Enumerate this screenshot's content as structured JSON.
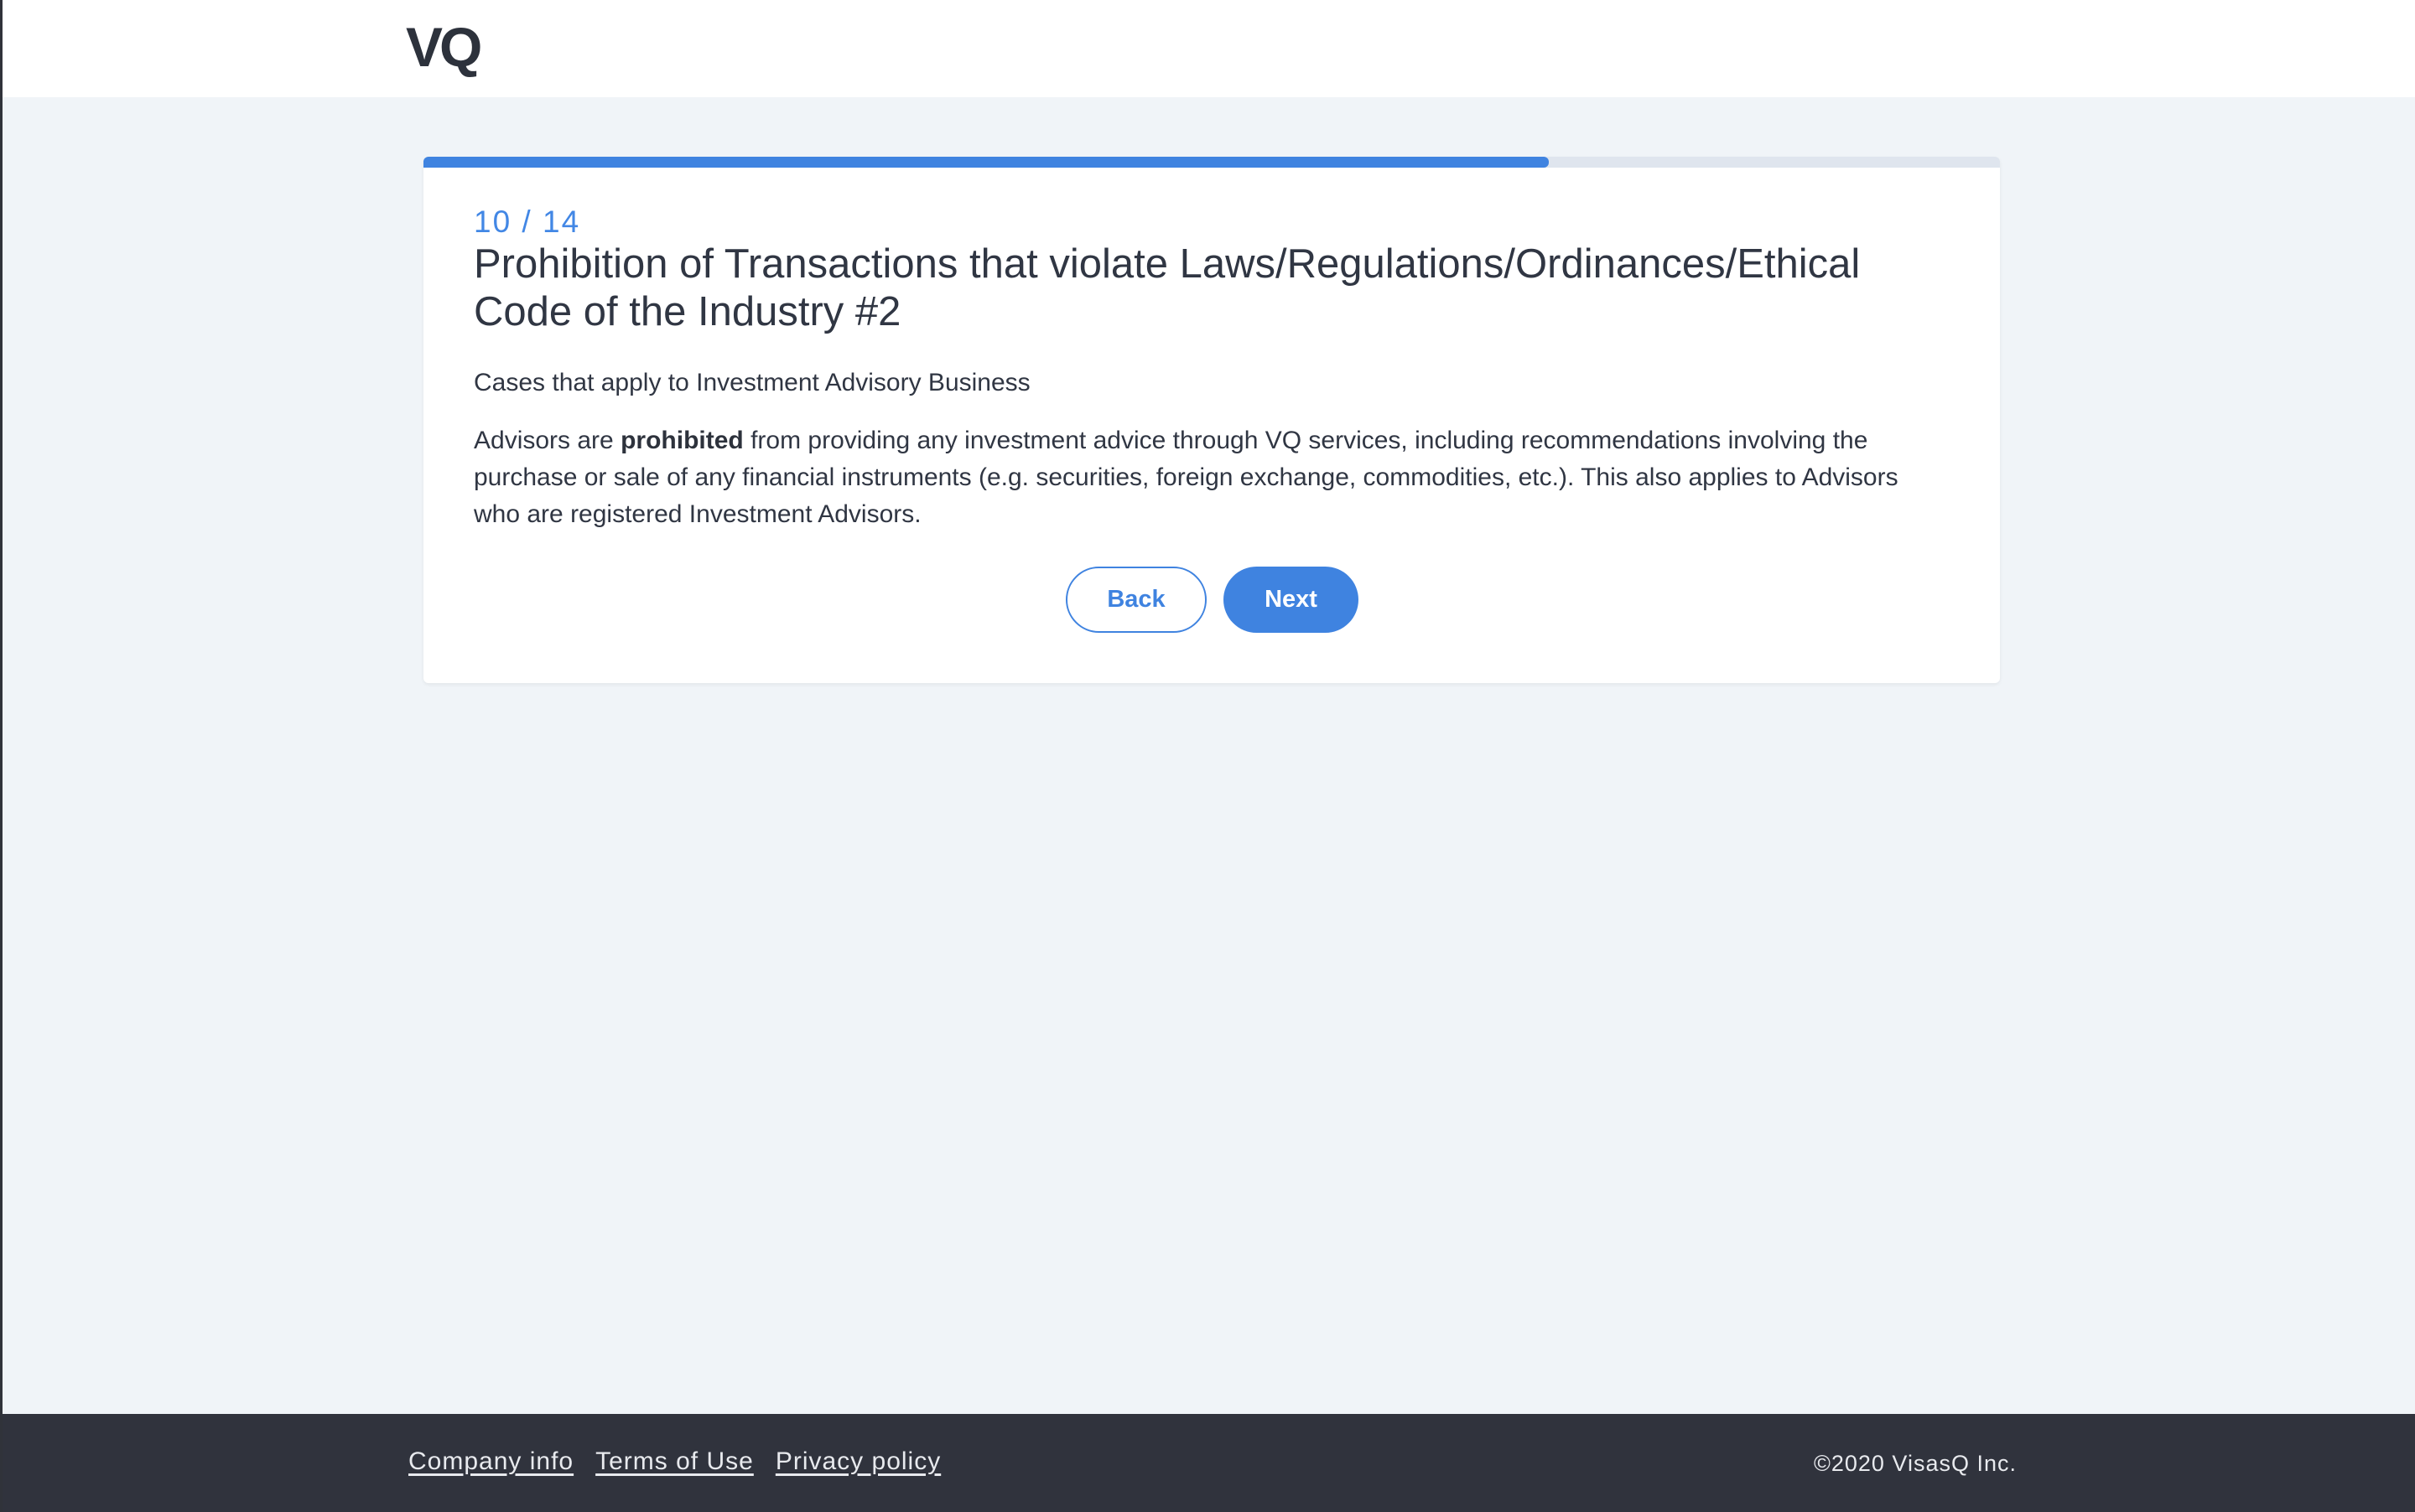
{
  "header": {
    "logo_text": "VQ"
  },
  "progress": {
    "current": 10,
    "total": 14,
    "label": "10 / 14",
    "fill_fraction": 0.714
  },
  "content": {
    "title": "Prohibition of Transactions that violate Laws/Regulations/Ordinances/Ethical Code of the Industry #2",
    "subtitle": "Cases that apply to Investment Advisory Business",
    "body_prefix": "Advisors are ",
    "body_bold": "prohibited",
    "body_suffix": " from providing any investment advice through VQ services, including recommendations involving the purchase or sale of any financial instruments (e.g. securities, foreign exchange, commodities, etc.). This also applies to Advisors who are registered Investment Advisors."
  },
  "buttons": {
    "back_label": "Back",
    "next_label": "Next"
  },
  "footer": {
    "links": [
      "Company info",
      "Terms of Use",
      "Privacy policy"
    ],
    "copyright": "©2020 VisasQ Inc."
  },
  "colors": {
    "accent": "#3f83e0",
    "background": "#f0f4f8",
    "footer_bg": "#30333d",
    "text": "#303643"
  }
}
